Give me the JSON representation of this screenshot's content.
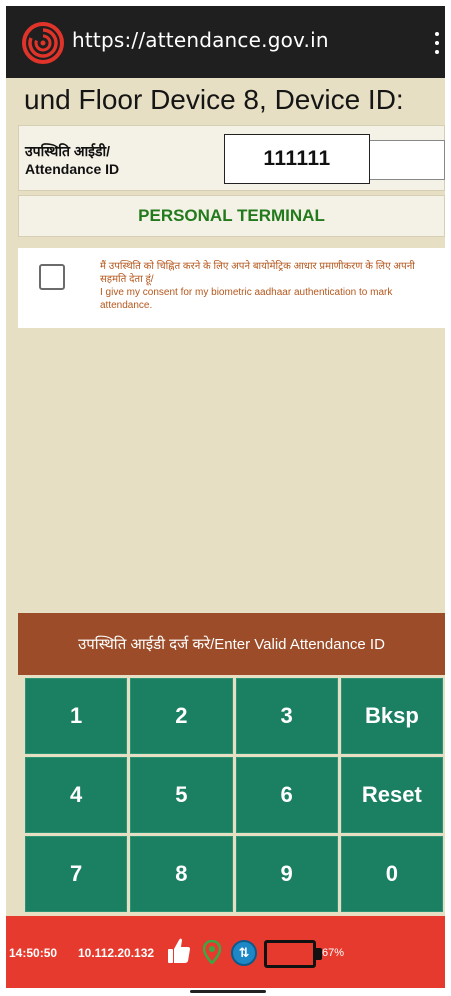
{
  "browser": {
    "url": "https://attendance.gov.in",
    "logo_icon": "aadhaar-fingerprint-logo",
    "menu_icon": "more-vert-icon"
  },
  "location_banner": "und Floor Device 8, Device ID:",
  "attendance_id": {
    "label_hindi": "उपस्थिति आईडी/",
    "label_english": "Attendance ID",
    "value": "111111"
  },
  "terminal_title": "PERSONAL TERMINAL",
  "consent": {
    "text_hindi": "मैं उपस्थिति को चिह्नित करने के लिए अपने बायोमेट्रिक आधार प्रमाणीकरण के लिए अपनी सहमति देता हूं/",
    "text_english": "I give my consent for my biometric aadhaar authentication to mark attendance.",
    "checked": false
  },
  "status_message": "उपस्थिति आईडी दर्ज करे/Enter Valid Attendance ID",
  "keypad": {
    "keys": [
      "1",
      "2",
      "3",
      "Bksp",
      "4",
      "5",
      "6",
      "Reset",
      "7",
      "8",
      "9",
      "0"
    ]
  },
  "footer": {
    "time": "14:50:50",
    "ip": "10.112.20.132",
    "battery_percent": "67%",
    "icons": [
      "thumbs-up-icon",
      "location-pin-icon",
      "sync-icon",
      "battery-icon"
    ]
  },
  "colors": {
    "background": "#e7dfc4",
    "topbar": "#1f1f1f",
    "terminal_title": "#237a1c",
    "consent_text": "#b5571c",
    "status_bar": "#9c4c28",
    "key": "#1b7f62",
    "footer": "#e63a2f",
    "sync": "#1e88c7",
    "pin": "#3aa845"
  }
}
